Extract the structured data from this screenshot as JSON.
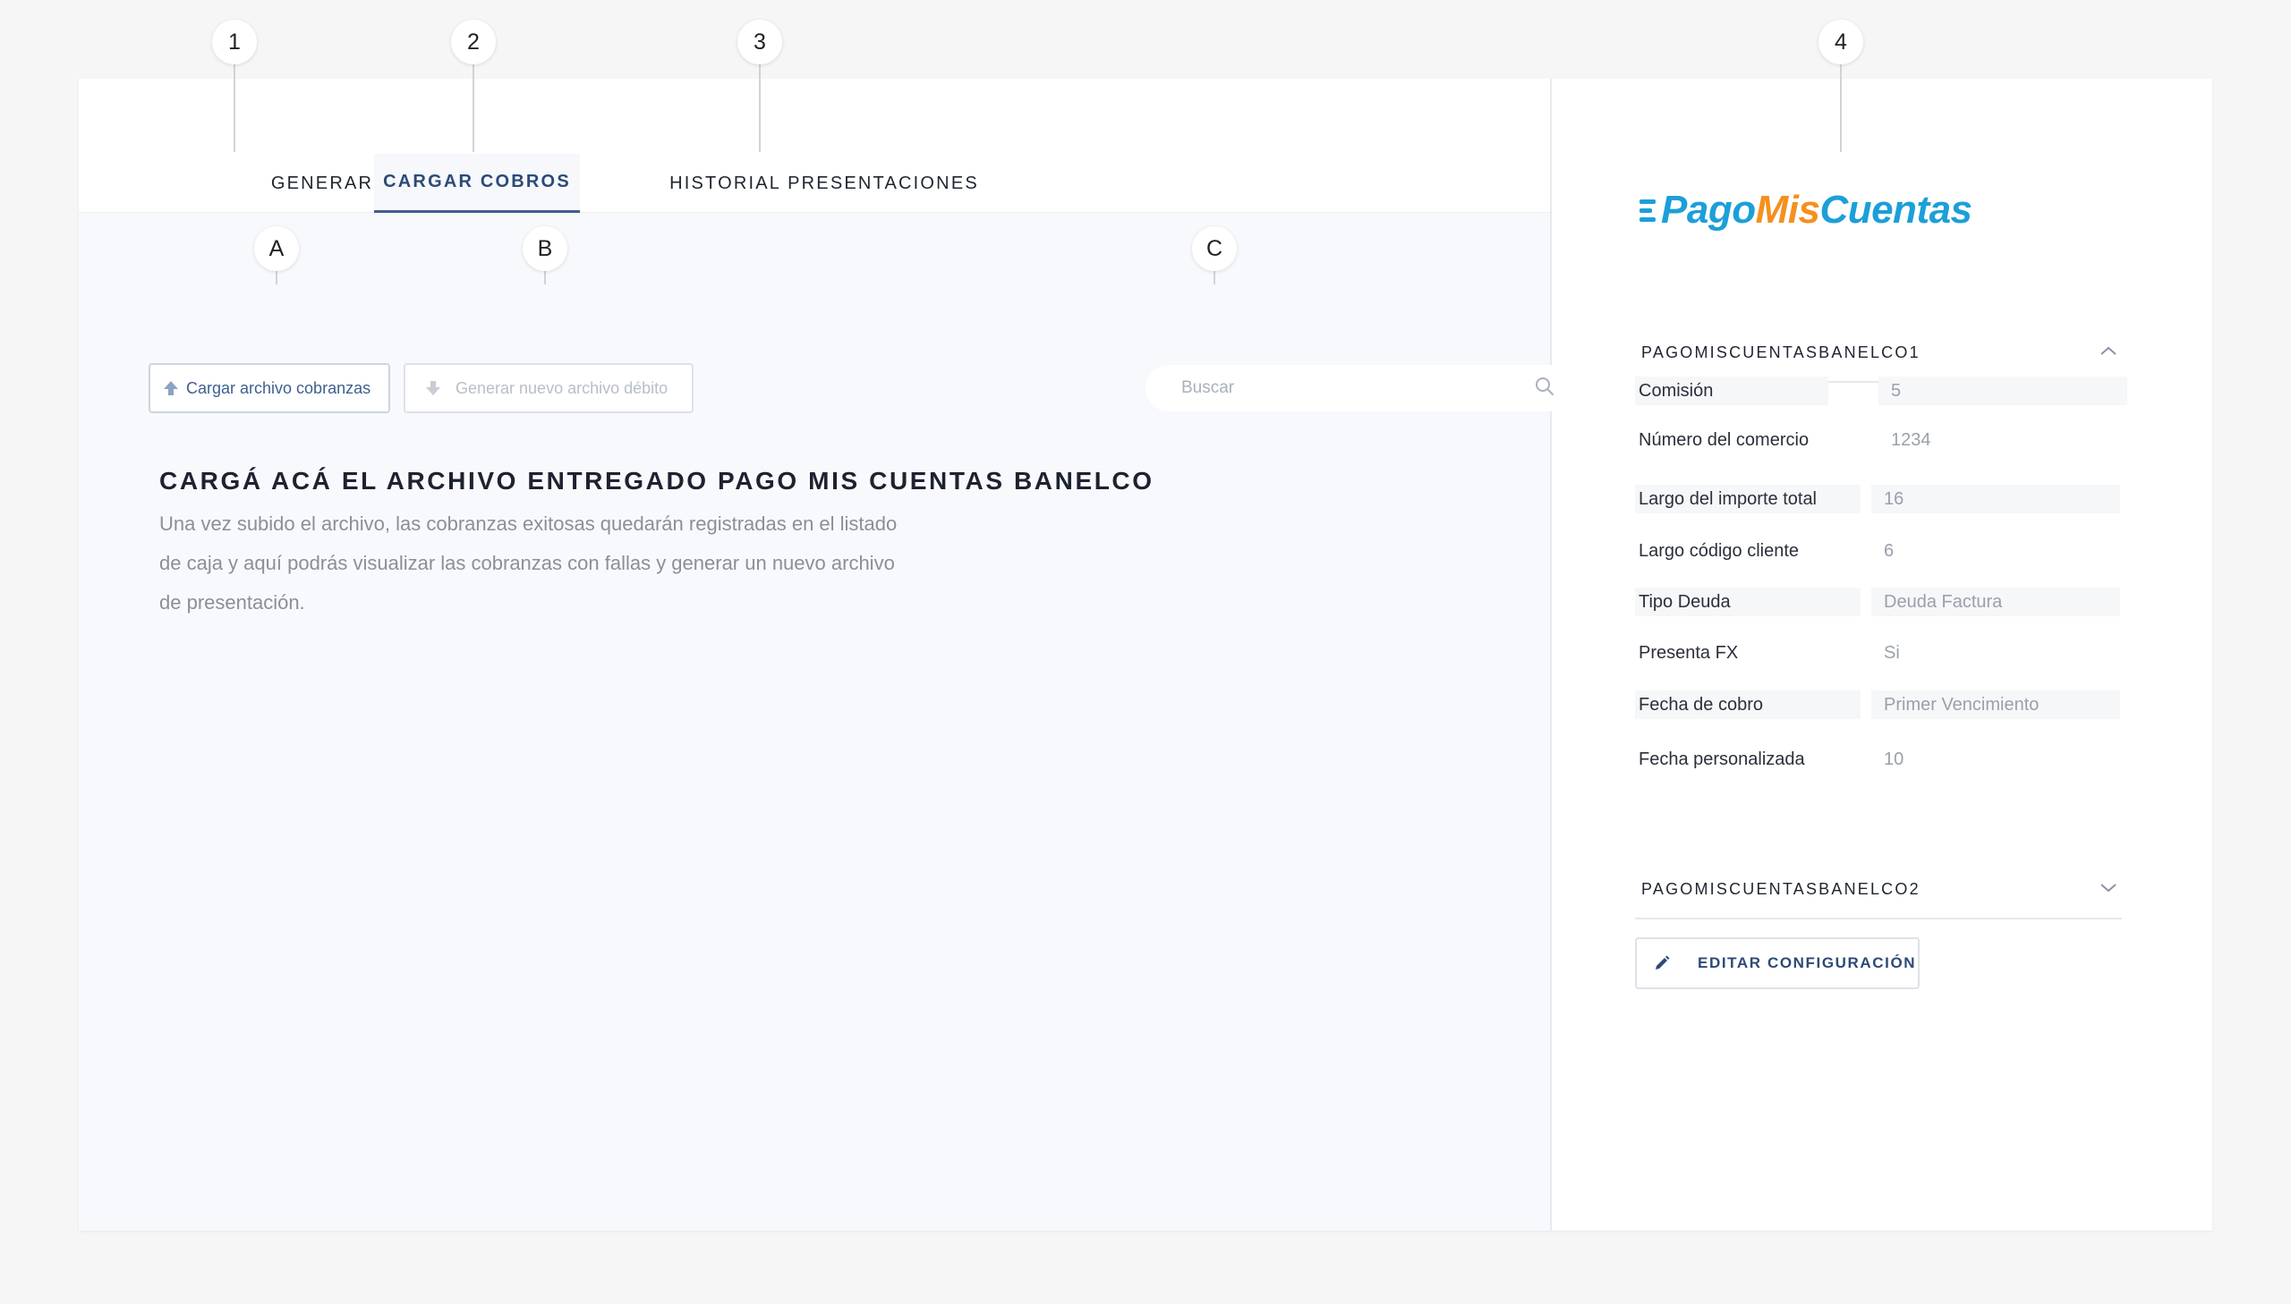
{
  "callouts": {
    "c1": "1",
    "c2": "2",
    "c3": "3",
    "c4": "4",
    "cA": "A",
    "cB": "B",
    "cC": "C"
  },
  "tabs": [
    {
      "label": "GENERAR",
      "active": false
    },
    {
      "label": "CARGAR COBROS",
      "active": true
    },
    {
      "label": "HISTORIAL PRESENTACIONES",
      "active": false
    }
  ],
  "toolbar": {
    "upload_label": "Cargar archivo cobranzas",
    "generate_label": "Generar nuevo archivo débito",
    "search_placeholder": "Buscar"
  },
  "main": {
    "title": "CARGÁ ACÁ EL ARCHIVO ENTREGADO PAGO MIS CUENTAS BANELCO",
    "description_lines": [
      "Una vez subido el archivo, las cobranzas exitosas quedarán registradas en el listado",
      "de caja y aquí podrás visualizar las cobranzas con fallas y generar un nuevo archivo",
      "de presentación."
    ]
  },
  "brand": {
    "part1": "PagoMis",
    "part1a": "Pago",
    "part2": "Mis",
    "part3": "Cuentas",
    "color_blue": "#1c9fd8",
    "color_orange": "#f5901e"
  },
  "config": {
    "section1_title": "PAGOMISCUENTASBANELCO1",
    "section2_title": "PAGOMISCUENTASBANELCO2",
    "fields": [
      {
        "label": "Comisión",
        "value": "5"
      },
      {
        "label": "Número del comercio",
        "value": "1234"
      },
      {
        "label": "Largo del importe total",
        "value": "16"
      },
      {
        "label": "Largo código cliente",
        "value": "6"
      },
      {
        "label": "Tipo Deuda",
        "value": "Deuda Factura"
      },
      {
        "label": "Presenta FX",
        "value": "Si"
      },
      {
        "label": "Fecha de cobro",
        "value": "Primer Vencimiento"
      },
      {
        "label": "Fecha personalizada",
        "value": "10"
      }
    ],
    "edit_button_label": "EDITAR CONFIGURACIÓN"
  },
  "colors": {
    "accent": "#3e5f8f",
    "tab_active": "#2c4a76",
    "muted_text": "#8a8f99"
  },
  "icons": {
    "upload": "arrow-up-icon",
    "download": "arrow-down-icon",
    "search": "search-icon",
    "collapse": "chevron-up-icon",
    "expand": "chevron-down-icon",
    "edit": "pencil-icon"
  }
}
